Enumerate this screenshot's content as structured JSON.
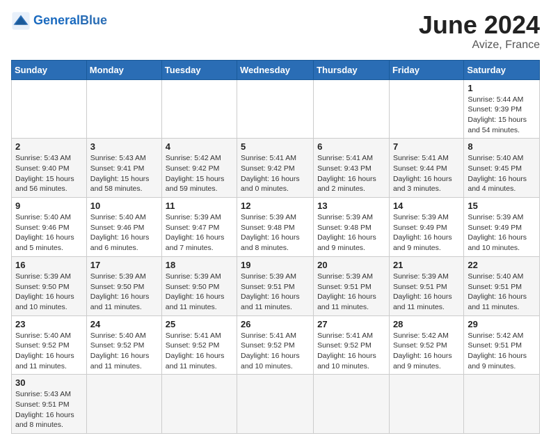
{
  "header": {
    "logo_general": "General",
    "logo_blue": "Blue",
    "month_year": "June 2024",
    "location": "Avize, France"
  },
  "weekdays": [
    "Sunday",
    "Monday",
    "Tuesday",
    "Wednesday",
    "Thursday",
    "Friday",
    "Saturday"
  ],
  "weeks": [
    [
      {
        "day": "",
        "sunrise": "",
        "sunset": "",
        "daylight": ""
      },
      {
        "day": "",
        "sunrise": "",
        "sunset": "",
        "daylight": ""
      },
      {
        "day": "",
        "sunrise": "",
        "sunset": "",
        "daylight": ""
      },
      {
        "day": "",
        "sunrise": "",
        "sunset": "",
        "daylight": ""
      },
      {
        "day": "",
        "sunrise": "",
        "sunset": "",
        "daylight": ""
      },
      {
        "day": "",
        "sunrise": "",
        "sunset": "",
        "daylight": ""
      },
      {
        "day": "1",
        "sunrise": "Sunrise: 5:44 AM",
        "sunset": "Sunset: 9:39 PM",
        "daylight": "Daylight: 15 hours and 54 minutes."
      }
    ],
    [
      {
        "day": "2",
        "sunrise": "Sunrise: 5:43 AM",
        "sunset": "Sunset: 9:40 PM",
        "daylight": "Daylight: 15 hours and 56 minutes."
      },
      {
        "day": "3",
        "sunrise": "Sunrise: 5:43 AM",
        "sunset": "Sunset: 9:41 PM",
        "daylight": "Daylight: 15 hours and 58 minutes."
      },
      {
        "day": "4",
        "sunrise": "Sunrise: 5:42 AM",
        "sunset": "Sunset: 9:42 PM",
        "daylight": "Daylight: 15 hours and 59 minutes."
      },
      {
        "day": "5",
        "sunrise": "Sunrise: 5:41 AM",
        "sunset": "Sunset: 9:42 PM",
        "daylight": "Daylight: 16 hours and 0 minutes."
      },
      {
        "day": "6",
        "sunrise": "Sunrise: 5:41 AM",
        "sunset": "Sunset: 9:43 PM",
        "daylight": "Daylight: 16 hours and 2 minutes."
      },
      {
        "day": "7",
        "sunrise": "Sunrise: 5:41 AM",
        "sunset": "Sunset: 9:44 PM",
        "daylight": "Daylight: 16 hours and 3 minutes."
      },
      {
        "day": "8",
        "sunrise": "Sunrise: 5:40 AM",
        "sunset": "Sunset: 9:45 PM",
        "daylight": "Daylight: 16 hours and 4 minutes."
      }
    ],
    [
      {
        "day": "9",
        "sunrise": "Sunrise: 5:40 AM",
        "sunset": "Sunset: 9:46 PM",
        "daylight": "Daylight: 16 hours and 5 minutes."
      },
      {
        "day": "10",
        "sunrise": "Sunrise: 5:40 AM",
        "sunset": "Sunset: 9:46 PM",
        "daylight": "Daylight: 16 hours and 6 minutes."
      },
      {
        "day": "11",
        "sunrise": "Sunrise: 5:39 AM",
        "sunset": "Sunset: 9:47 PM",
        "daylight": "Daylight: 16 hours and 7 minutes."
      },
      {
        "day": "12",
        "sunrise": "Sunrise: 5:39 AM",
        "sunset": "Sunset: 9:48 PM",
        "daylight": "Daylight: 16 hours and 8 minutes."
      },
      {
        "day": "13",
        "sunrise": "Sunrise: 5:39 AM",
        "sunset": "Sunset: 9:48 PM",
        "daylight": "Daylight: 16 hours and 9 minutes."
      },
      {
        "day": "14",
        "sunrise": "Sunrise: 5:39 AM",
        "sunset": "Sunset: 9:49 PM",
        "daylight": "Daylight: 16 hours and 9 minutes."
      },
      {
        "day": "15",
        "sunrise": "Sunrise: 5:39 AM",
        "sunset": "Sunset: 9:49 PM",
        "daylight": "Daylight: 16 hours and 10 minutes."
      }
    ],
    [
      {
        "day": "16",
        "sunrise": "Sunrise: 5:39 AM",
        "sunset": "Sunset: 9:50 PM",
        "daylight": "Daylight: 16 hours and 10 minutes."
      },
      {
        "day": "17",
        "sunrise": "Sunrise: 5:39 AM",
        "sunset": "Sunset: 9:50 PM",
        "daylight": "Daylight: 16 hours and 11 minutes."
      },
      {
        "day": "18",
        "sunrise": "Sunrise: 5:39 AM",
        "sunset": "Sunset: 9:50 PM",
        "daylight": "Daylight: 16 hours and 11 minutes."
      },
      {
        "day": "19",
        "sunrise": "Sunrise: 5:39 AM",
        "sunset": "Sunset: 9:51 PM",
        "daylight": "Daylight: 16 hours and 11 minutes."
      },
      {
        "day": "20",
        "sunrise": "Sunrise: 5:39 AM",
        "sunset": "Sunset: 9:51 PM",
        "daylight": "Daylight: 16 hours and 11 minutes."
      },
      {
        "day": "21",
        "sunrise": "Sunrise: 5:39 AM",
        "sunset": "Sunset: 9:51 PM",
        "daylight": "Daylight: 16 hours and 11 minutes."
      },
      {
        "day": "22",
        "sunrise": "Sunrise: 5:40 AM",
        "sunset": "Sunset: 9:51 PM",
        "daylight": "Daylight: 16 hours and 11 minutes."
      }
    ],
    [
      {
        "day": "23",
        "sunrise": "Sunrise: 5:40 AM",
        "sunset": "Sunset: 9:52 PM",
        "daylight": "Daylight: 16 hours and 11 minutes."
      },
      {
        "day": "24",
        "sunrise": "Sunrise: 5:40 AM",
        "sunset": "Sunset: 9:52 PM",
        "daylight": "Daylight: 16 hours and 11 minutes."
      },
      {
        "day": "25",
        "sunrise": "Sunrise: 5:41 AM",
        "sunset": "Sunset: 9:52 PM",
        "daylight": "Daylight: 16 hours and 11 minutes."
      },
      {
        "day": "26",
        "sunrise": "Sunrise: 5:41 AM",
        "sunset": "Sunset: 9:52 PM",
        "daylight": "Daylight: 16 hours and 10 minutes."
      },
      {
        "day": "27",
        "sunrise": "Sunrise: 5:41 AM",
        "sunset": "Sunset: 9:52 PM",
        "daylight": "Daylight: 16 hours and 10 minutes."
      },
      {
        "day": "28",
        "sunrise": "Sunrise: 5:42 AM",
        "sunset": "Sunset: 9:52 PM",
        "daylight": "Daylight: 16 hours and 9 minutes."
      },
      {
        "day": "29",
        "sunrise": "Sunrise: 5:42 AM",
        "sunset": "Sunset: 9:51 PM",
        "daylight": "Daylight: 16 hours and 9 minutes."
      }
    ],
    [
      {
        "day": "30",
        "sunrise": "Sunrise: 5:43 AM",
        "sunset": "Sunset: 9:51 PM",
        "daylight": "Daylight: 16 hours and 8 minutes."
      },
      {
        "day": "",
        "sunrise": "",
        "sunset": "",
        "daylight": ""
      },
      {
        "day": "",
        "sunrise": "",
        "sunset": "",
        "daylight": ""
      },
      {
        "day": "",
        "sunrise": "",
        "sunset": "",
        "daylight": ""
      },
      {
        "day": "",
        "sunrise": "",
        "sunset": "",
        "daylight": ""
      },
      {
        "day": "",
        "sunrise": "",
        "sunset": "",
        "daylight": ""
      },
      {
        "day": "",
        "sunrise": "",
        "sunset": "",
        "daylight": ""
      }
    ]
  ]
}
